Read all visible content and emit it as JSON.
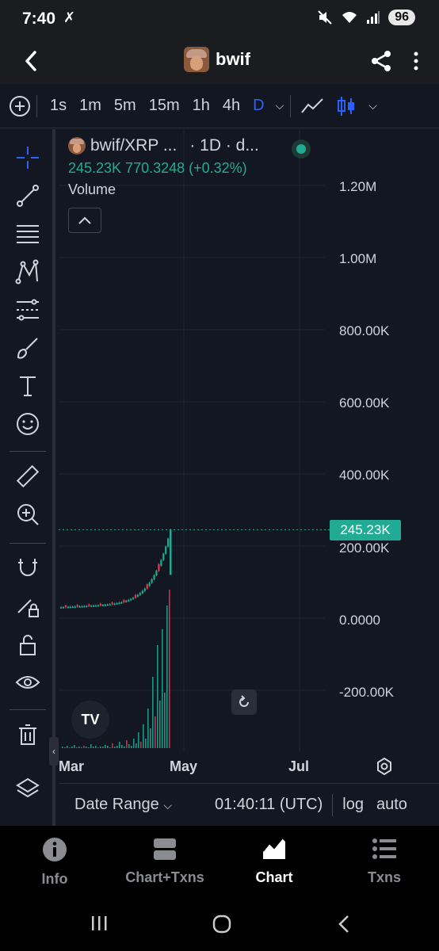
{
  "status": {
    "time": "7:40",
    "x_icon": "✗",
    "battery": "96"
  },
  "header": {
    "title": "bwif"
  },
  "toolbar": {
    "intervals": [
      "1s",
      "1m",
      "5m",
      "15m",
      "1h",
      "4h",
      "D"
    ],
    "active_interval": "D"
  },
  "legend": {
    "symbol": "bwif/XRP ...",
    "meta": "· 1D · d...",
    "values": "245.23K 770.3248 (+0.32%)",
    "indicator": "Volume"
  },
  "y_axis": {
    "labels": [
      "1.20M",
      "1.00M",
      "800.00K",
      "600.00K",
      "400.00K",
      "200.00K",
      "0.0000",
      "-200.00K"
    ],
    "current_price_tag": "245.23K"
  },
  "x_axis": {
    "labels": [
      "Mar",
      "May",
      "Jul"
    ]
  },
  "chart_controls": {
    "date_range": "Date Range",
    "clock": "01:40:11 (UTC)",
    "log": "log",
    "auto": "auto"
  },
  "bottom_nav": {
    "items": [
      {
        "label": "Info",
        "icon": "info-icon"
      },
      {
        "label": "Chart+Txns",
        "icon": "split-view-icon"
      },
      {
        "label": "Chart",
        "icon": "chart-icon"
      },
      {
        "label": "Txns",
        "icon": "list-icon"
      }
    ],
    "active": "Chart"
  },
  "colors": {
    "accent": "#2962ff",
    "up": "#22ab94",
    "down": "#f23645",
    "background": "#131722"
  },
  "chart_data": {
    "type": "candlestick",
    "series_price": [
      {
        "x": "Mar",
        "close": 40000
      },
      {
        "x": "Apr-early",
        "close": 50000
      },
      {
        "x": "Apr-mid",
        "close": 80000
      },
      {
        "x": "Apr-late",
        "close": 150000
      },
      {
        "x": "May",
        "close": 245230
      }
    ],
    "current_value": 245230,
    "ylim": [
      -350000,
      1300000
    ],
    "y_ticks": [
      "1.20M",
      "1.00M",
      "800.00K",
      "600.00K",
      "400.00K",
      "200.00K",
      "0.0000",
      "-200.00K"
    ],
    "x_ticks": [
      "Mar",
      "May",
      "Jul"
    ],
    "volume_bars": true,
    "grid": true
  }
}
